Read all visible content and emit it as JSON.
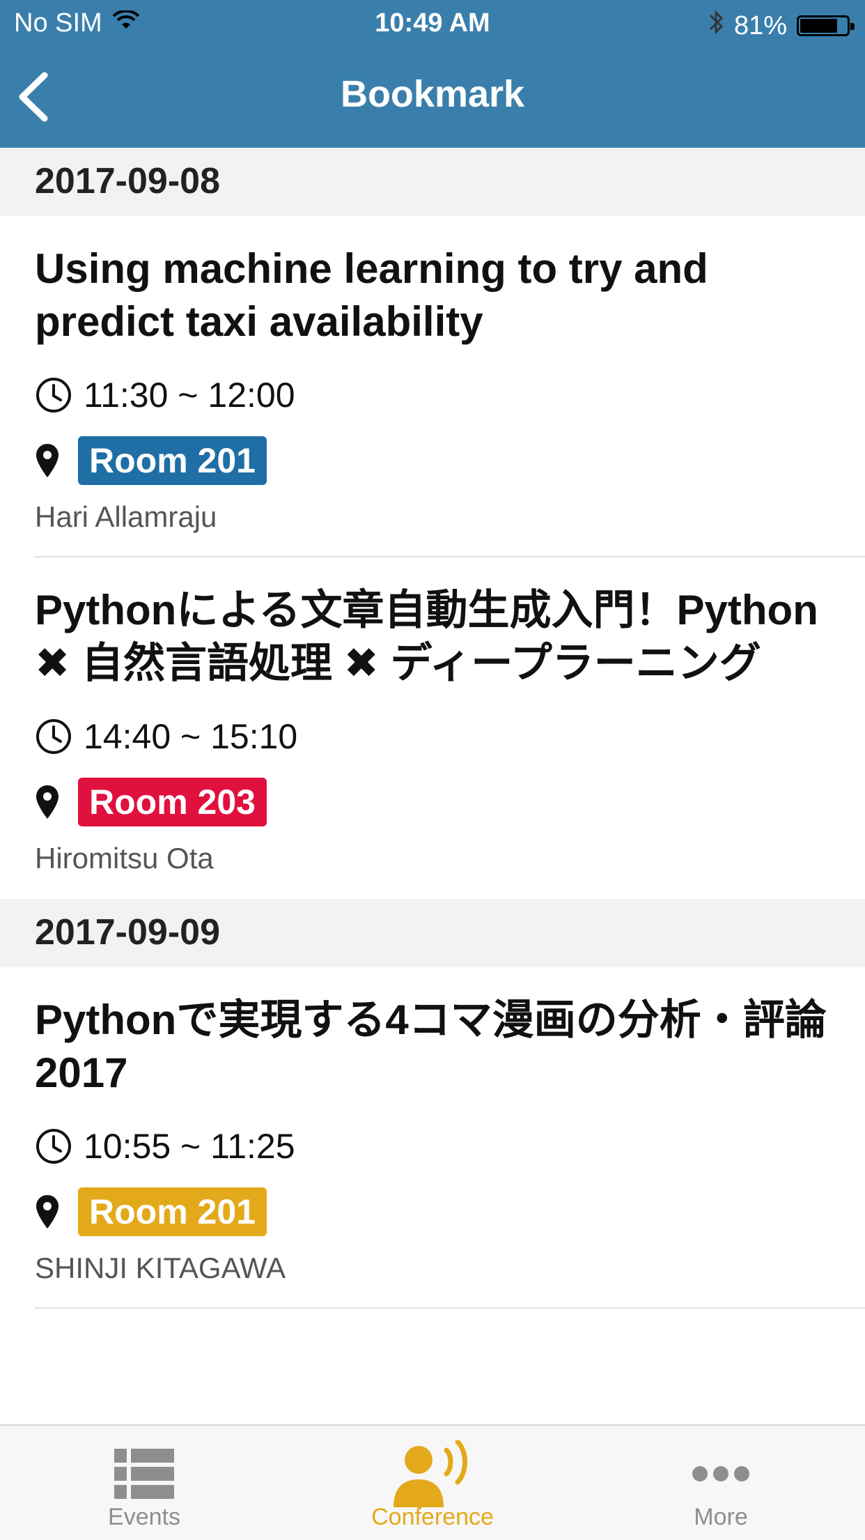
{
  "status_bar": {
    "carrier": "No SIM",
    "time": "10:49 AM",
    "battery_percent": "81%",
    "battery_level": 0.81
  },
  "nav": {
    "title": "Bookmark",
    "back_icon": "chevron-left-icon"
  },
  "sections": [
    {
      "date": "2017-09-08",
      "items": [
        {
          "title": "Using machine learning to try and predict taxi availability",
          "time": "11:30 ~ 12:00",
          "room": "Room 201",
          "room_color": "#1f6ea6",
          "speaker": "Hari Allamraju"
        },
        {
          "title": "Pythonによる文章自動生成入門！Python ✖ 自然言語処理 ✖ ディープラーニング",
          "time": "14:40 ~ 15:10",
          "room": "Room 203",
          "room_color": "#e0103f",
          "speaker": "Hiromitsu Ota"
        }
      ]
    },
    {
      "date": "2017-09-09",
      "items": [
        {
          "title": "Pythonで実現する4コマ漫画の分析・評論 2017",
          "time": "10:55 ~ 11:25",
          "room": "Room 201",
          "room_color": "#e4a91a",
          "speaker": "SHINJI KITAGAWA"
        }
      ]
    }
  ],
  "tabbar": {
    "tabs": [
      {
        "label": "Events",
        "icon": "list-icon",
        "active": false
      },
      {
        "label": "Conference",
        "icon": "speaker-icon",
        "active": true
      },
      {
        "label": "More",
        "icon": "more-icon",
        "active": false
      }
    ],
    "active_color": "#e4a91a",
    "inactive_color": "#8e8e8e"
  },
  "colors": {
    "header_bg": "#3a7fac"
  }
}
